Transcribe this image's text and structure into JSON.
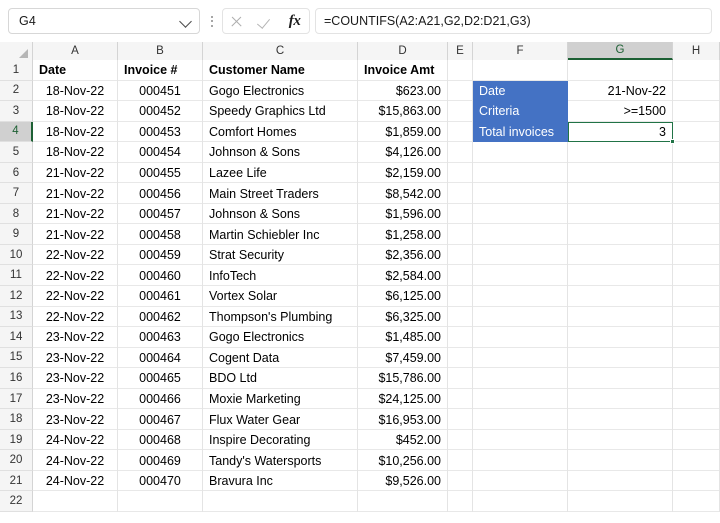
{
  "formula_bar": {
    "name_box_value": "G4",
    "formula": "=COUNTIFS(A2:A21,G2,D2:D21,G3)",
    "fx_label": "fx",
    "icons": {
      "dropdown": "chevron-down-icon",
      "more": "more-options-icon",
      "cancel": "cancel-icon",
      "enter": "enter-icon",
      "function": "insert-function-icon"
    }
  },
  "grid": {
    "column_headers": [
      "A",
      "B",
      "C",
      "D",
      "E",
      "F",
      "G",
      "H"
    ],
    "selected_column": "G",
    "selected_row": "4",
    "selected_cell": "G4",
    "row_numbers": [
      "1",
      "2",
      "3",
      "4",
      "5",
      "6",
      "7",
      "8",
      "9",
      "10",
      "11",
      "12",
      "13",
      "14",
      "15",
      "16",
      "17",
      "18",
      "19",
      "20",
      "21",
      "22"
    ],
    "table_headers": {
      "A": "Date",
      "B": "Invoice #",
      "C": "Customer Name",
      "D": "Invoice Amt"
    },
    "rows": [
      {
        "date": "18-Nov-22",
        "invoice": "000451",
        "customer": "Gogo Electronics",
        "amount": "$623.00"
      },
      {
        "date": "18-Nov-22",
        "invoice": "000452",
        "customer": "Speedy Graphics Ltd",
        "amount": "$15,863.00"
      },
      {
        "date": "18-Nov-22",
        "invoice": "000453",
        "customer": "Comfort Homes",
        "amount": "$1,859.00"
      },
      {
        "date": "18-Nov-22",
        "invoice": "000454",
        "customer": "Johnson & Sons",
        "amount": "$4,126.00"
      },
      {
        "date": "21-Nov-22",
        "invoice": "000455",
        "customer": "Lazee Life",
        "amount": "$2,159.00"
      },
      {
        "date": "21-Nov-22",
        "invoice": "000456",
        "customer": "Main Street Traders",
        "amount": "$8,542.00"
      },
      {
        "date": "21-Nov-22",
        "invoice": "000457",
        "customer": "Johnson & Sons",
        "amount": "$1,596.00"
      },
      {
        "date": "21-Nov-22",
        "invoice": "000458",
        "customer": "Martin Schiebler Inc",
        "amount": "$1,258.00"
      },
      {
        "date": "22-Nov-22",
        "invoice": "000459",
        "customer": "Strat Security",
        "amount": "$2,356.00"
      },
      {
        "date": "22-Nov-22",
        "invoice": "000460",
        "customer": "InfoTech",
        "amount": "$2,584.00"
      },
      {
        "date": "22-Nov-22",
        "invoice": "000461",
        "customer": "Vortex Solar",
        "amount": "$6,125.00"
      },
      {
        "date": "22-Nov-22",
        "invoice": "000462",
        "customer": "Thompson's Plumbing",
        "amount": "$6,325.00"
      },
      {
        "date": "23-Nov-22",
        "invoice": "000463",
        "customer": "Gogo Electronics",
        "amount": "$1,485.00"
      },
      {
        "date": "23-Nov-22",
        "invoice": "000464",
        "customer": "Cogent Data",
        "amount": "$7,459.00"
      },
      {
        "date": "23-Nov-22",
        "invoice": "000465",
        "customer": "BDO Ltd",
        "amount": "$15,786.00"
      },
      {
        "date": "23-Nov-22",
        "invoice": "000466",
        "customer": "Moxie Marketing",
        "amount": "$24,125.00"
      },
      {
        "date": "23-Nov-22",
        "invoice": "000467",
        "customer": "Flux Water Gear",
        "amount": "$16,953.00"
      },
      {
        "date": "24-Nov-22",
        "invoice": "000468",
        "customer": "Inspire Decorating",
        "amount": "$452.00"
      },
      {
        "date": "24-Nov-22",
        "invoice": "000469",
        "customer": "Tandy's Watersports",
        "amount": "$10,256.00"
      },
      {
        "date": "24-Nov-22",
        "invoice": "000470",
        "customer": "Bravura Inc",
        "amount": "$9,526.00"
      }
    ],
    "criteria_panel": {
      "accent_color": "#4472C4",
      "label_date": "Date",
      "label_criteria": "Criteria",
      "label_total": "Total invoices",
      "value_date": "21-Nov-22",
      "value_criteria": ">=1500",
      "value_total": "3"
    }
  }
}
